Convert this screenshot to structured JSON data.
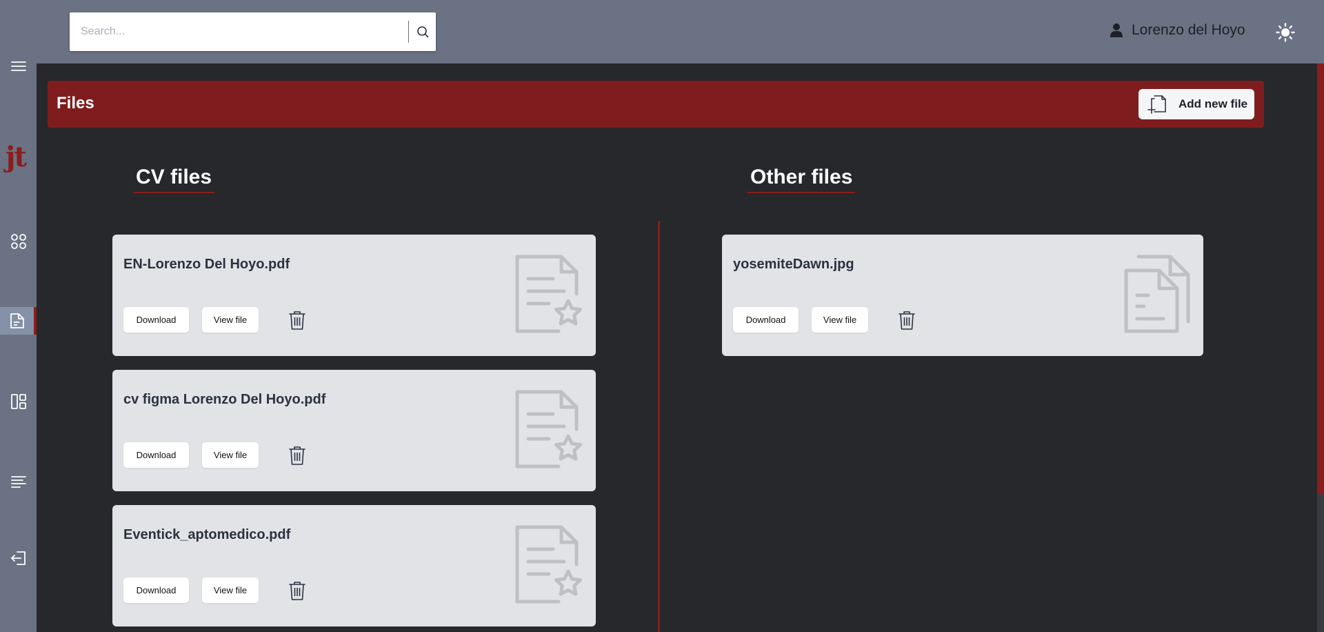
{
  "sidebar": {
    "logo": "jt",
    "items": [
      {
        "name": "menu",
        "icon": "hamburger-menu-icon"
      },
      {
        "name": "dashboard",
        "icon": "grid-icon"
      },
      {
        "name": "files",
        "icon": "document-icon",
        "active": true
      },
      {
        "name": "board",
        "icon": "layout-icon"
      },
      {
        "name": "list",
        "icon": "text-list-icon"
      },
      {
        "name": "logout",
        "icon": "logout-icon"
      }
    ]
  },
  "topbar": {
    "search": {
      "placeholder": "Search...",
      "value": ""
    },
    "user_name": "Lorenzo del Hoyo",
    "theme_icon": "sun-icon"
  },
  "files_header": {
    "title": "Files",
    "add_label": "Add new file"
  },
  "cv_section": {
    "title": "CV files",
    "files": [
      {
        "name": "EN-Lorenzo Del Hoyo.pdf",
        "download_label": "Download",
        "view_label": "View file"
      },
      {
        "name": "cv figma Lorenzo Del Hoyo.pdf",
        "download_label": "Download",
        "view_label": "View file"
      },
      {
        "name": "Eventick_aptomedico.pdf",
        "download_label": "Download",
        "view_label": "View file"
      }
    ]
  },
  "other_section": {
    "title": "Other files",
    "files": [
      {
        "name": "yosemiteDawn.jpg",
        "download_label": "Download",
        "view_label": "View file"
      }
    ]
  },
  "colors": {
    "accent": "#7f1d1e",
    "sidebar": "#6a7283",
    "background": "#27282c",
    "card": "#e2e3e6"
  }
}
